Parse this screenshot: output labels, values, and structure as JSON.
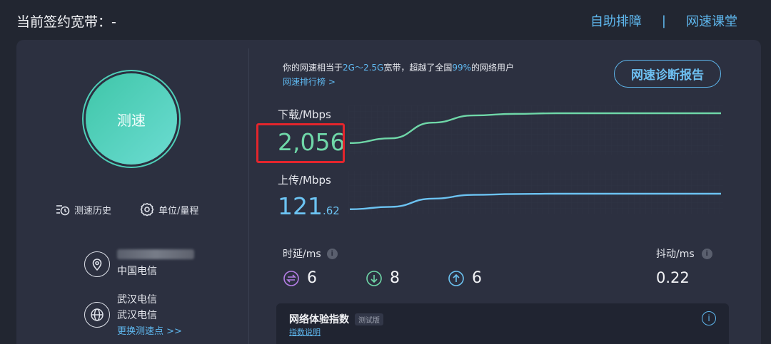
{
  "header": {
    "title": "当前签约宽带：-",
    "self_help": "自助排障",
    "separator": "|",
    "speed_class": "网速课堂"
  },
  "left": {
    "test_button": "测速",
    "history": "测速历史",
    "units": "单位/量程",
    "isp_name": "中国电信",
    "node_line1": "武汉电信",
    "node_line2": "武汉电信",
    "change_node": "更换测速点 >>"
  },
  "summary": {
    "prefix": "你的网速相当于",
    "range": "2G～2.5G",
    "middle": "宽带，超越了全国",
    "percent": "99%",
    "suffix": "的网络用户",
    "rank_link": "网速排行榜 >"
  },
  "report_button": "网速诊断报告",
  "download": {
    "label": "下载/Mbps",
    "value": "2,056",
    "series": [
      0.05,
      0.2,
      0.7,
      0.93,
      0.98,
      1.0,
      1.0,
      1.0,
      1.0,
      1.0
    ]
  },
  "upload": {
    "label": "上传/Mbps",
    "value_int": "121",
    "value_dec": ".62",
    "series": [
      0.05,
      0.2,
      0.7,
      0.93,
      0.98,
      1.0,
      1.0,
      1.0,
      1.0,
      1.0
    ]
  },
  "latency": {
    "label": "时延/ms",
    "idle": "6",
    "download": "8",
    "upload": "6"
  },
  "jitter": {
    "label": "抖动/ms",
    "value": "0.22"
  },
  "experience": {
    "title": "网络体验指数",
    "tag": "测试版",
    "link": "指数说明"
  },
  "colors": {
    "accent": "#5fb8ef",
    "download": "#6fd7a8",
    "upload": "#6cc3f2",
    "highlight": "#e3252c"
  }
}
